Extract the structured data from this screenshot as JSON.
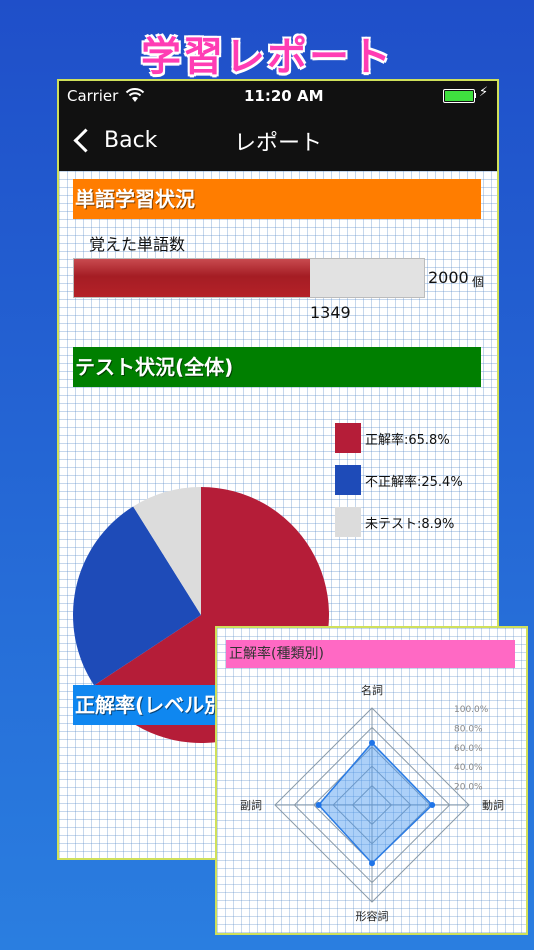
{
  "promo": {
    "title": "学習レポート"
  },
  "status_bar": {
    "carrier": "Carrier",
    "time": "11:20 AM"
  },
  "nav": {
    "back_label": "Back",
    "title": "レポート"
  },
  "words_section": {
    "header": "単語学習状況",
    "label": "覚えた単語数",
    "learned": "1349",
    "total": "2000",
    "unit": "個",
    "progress": 0.6745
  },
  "test_section": {
    "header": "テスト状況(全体)",
    "legend": [
      {
        "label": "正解率:65.8%",
        "color": "#b51d38"
      },
      {
        "label": "不正解率:25.4%",
        "color": "#1e4bb8"
      },
      {
        "label": "未テスト:8.9%",
        "color": "#dcdcdc"
      }
    ]
  },
  "level_section": {
    "header": "正解率(レベル別)"
  },
  "chart_data": [
    {
      "type": "pie",
      "labels": [
        "正解率",
        "不正解率",
        "未テスト"
      ],
      "values": [
        65.8,
        25.4,
        8.9
      ],
      "colors": [
        "#b51d38",
        "#1e4bb8",
        "#dcdcdc"
      ]
    },
    {
      "type": "radar",
      "title": "正解率(種類別)",
      "categories": [
        "名詞",
        "動詞",
        "形容詞",
        "副詞"
      ],
      "values": [
        64,
        62,
        60,
        55
      ],
      "range": [
        0,
        100
      ],
      "ticks": [
        "20.0%",
        "40.0%",
        "60.0%",
        "80.0%",
        "100.0%"
      ]
    }
  ]
}
